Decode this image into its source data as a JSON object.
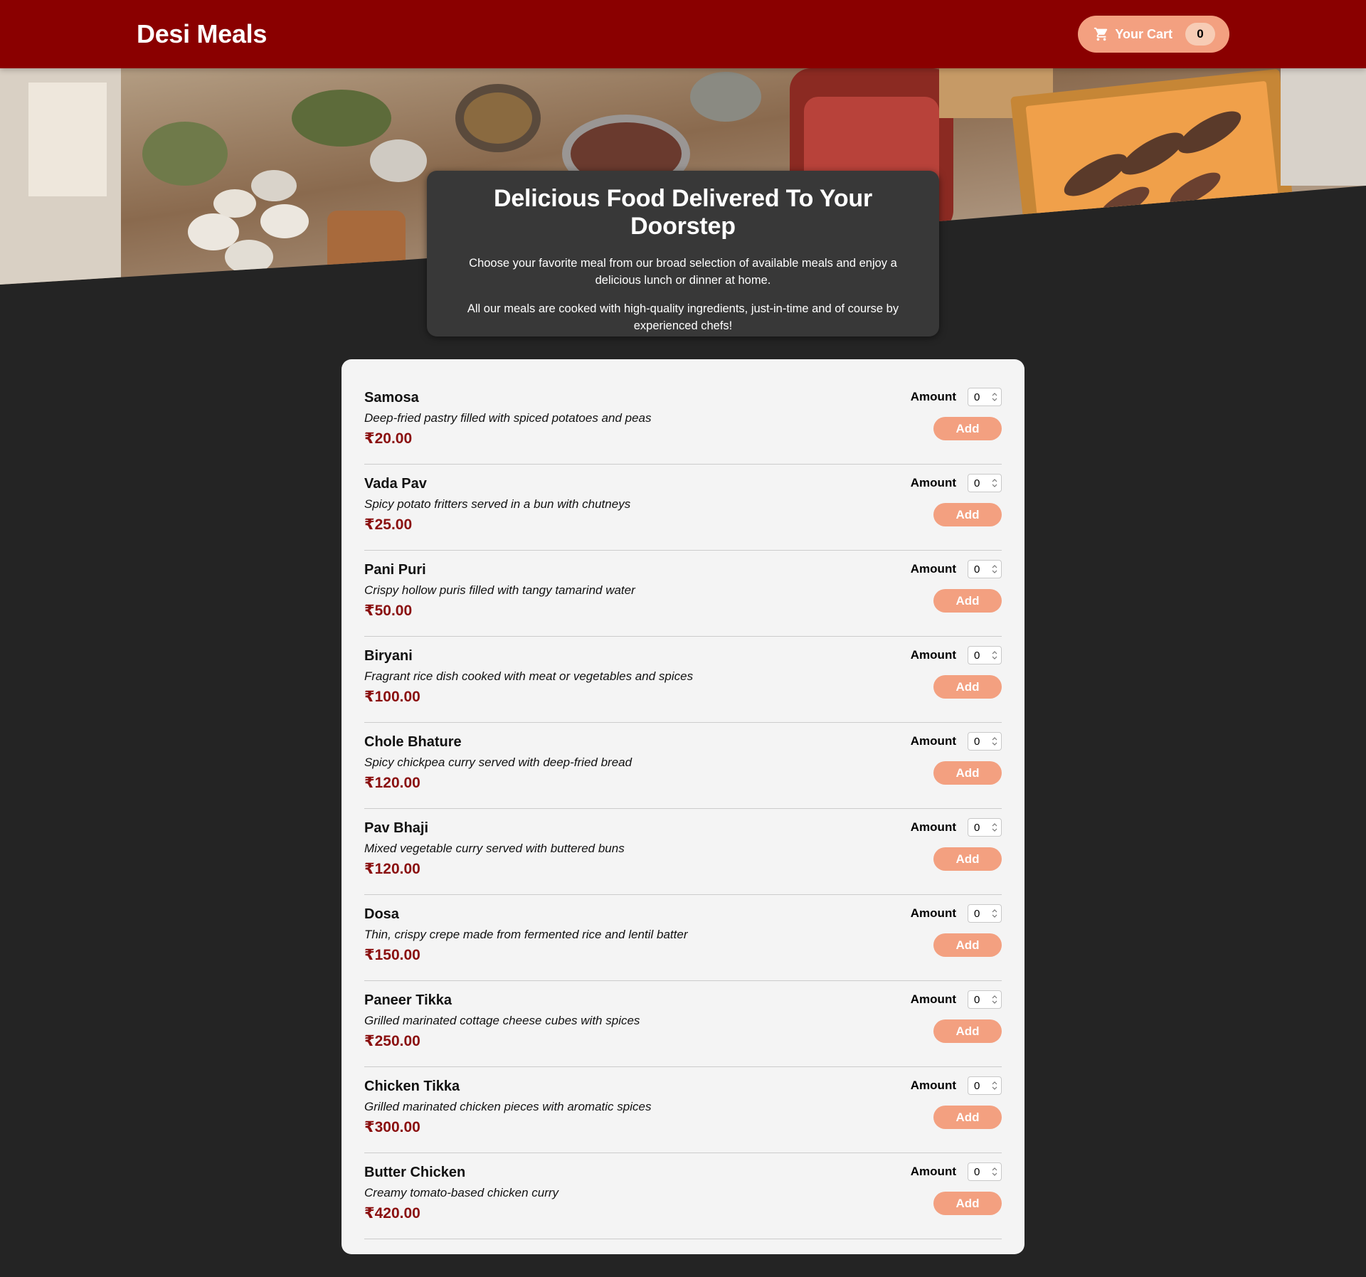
{
  "header": {
    "brand": "Desi Meals",
    "cart_label": "Your Cart",
    "cart_count": "0",
    "cart_icon": "shopping-cart-icon"
  },
  "hero": {
    "image": "catering-buffet-table-photo"
  },
  "summary": {
    "title": "Delicious Food Delivered To Your Doorstep",
    "paragraph1": "Choose your favorite meal from our broad selection of available meals and enjoy a delicious lunch or dinner at home.",
    "paragraph2": "All our meals are cooked with high-quality ingredients, just-in-time and of course by experienced chefs!"
  },
  "meal_form": {
    "amount_label": "Amount",
    "add_label": "Add"
  },
  "meals": [
    {
      "name": "Samosa",
      "description": "Deep-fried pastry filled with spiced potatoes and peas",
      "price": "₹20.00",
      "amount": "0"
    },
    {
      "name": "Vada Pav",
      "description": "Spicy potato fritters served in a bun with chutneys",
      "price": "₹25.00",
      "amount": "0"
    },
    {
      "name": "Pani Puri",
      "description": "Crispy hollow puris filled with tangy tamarind water",
      "price": "₹50.00",
      "amount": "0"
    },
    {
      "name": "Biryani",
      "description": "Fragrant rice dish cooked with meat or vegetables and spices",
      "price": "₹100.00",
      "amount": "0"
    },
    {
      "name": "Chole Bhature",
      "description": "Spicy chickpea curry served with deep-fried bread",
      "price": "₹120.00",
      "amount": "0"
    },
    {
      "name": "Pav Bhaji",
      "description": "Mixed vegetable curry served with buttered buns",
      "price": "₹120.00",
      "amount": "0"
    },
    {
      "name": "Dosa",
      "description": "Thin, crispy crepe made from fermented rice and lentil batter",
      "price": "₹150.00",
      "amount": "0"
    },
    {
      "name": "Paneer Tikka",
      "description": "Grilled marinated cottage cheese cubes with spices",
      "price": "₹250.00",
      "amount": "0"
    },
    {
      "name": "Chicken Tikka",
      "description": "Grilled marinated chicken pieces with aromatic spices",
      "price": "₹300.00",
      "amount": "0"
    },
    {
      "name": "Butter Chicken",
      "description": "Creamy tomato-based chicken curry",
      "price": "₹420.00",
      "amount": "0"
    }
  ],
  "colors": {
    "header_bg": "#8a0000",
    "page_bg": "#242424",
    "accent": "#f3a080",
    "price": "#8a0f0f",
    "card_bg": "#f4f4f4",
    "summary_bg": "#383838"
  }
}
